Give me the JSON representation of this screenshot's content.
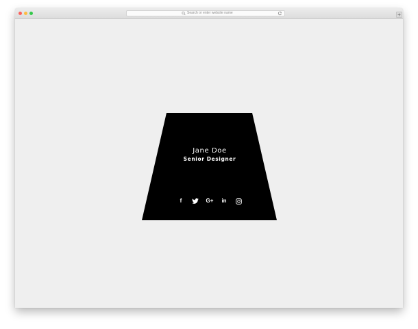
{
  "browser": {
    "address_placeholder": "Search or enter website name",
    "icons": {
      "search": "search-icon",
      "reload": "reload-icon",
      "new_tab": "plus-icon"
    },
    "traffic_lights": [
      "#fc605b",
      "#fdbc40",
      "#34c84a"
    ]
  },
  "card": {
    "name": "Jane Doe",
    "role": "Senior Designer",
    "background_color": "#000000",
    "text_color": "#ffffff",
    "socials": [
      {
        "id": "facebook",
        "icon": "facebook-icon",
        "text": "f"
      },
      {
        "id": "twitter",
        "icon": "twitter-icon",
        "text": ""
      },
      {
        "id": "google-plus",
        "icon": "google-plus-icon",
        "text": "G+"
      },
      {
        "id": "linkedin",
        "icon": "linkedin-icon",
        "text": "in"
      },
      {
        "id": "instagram",
        "icon": "instagram-icon",
        "text": ""
      }
    ]
  },
  "page": {
    "background_color": "#efefef"
  }
}
